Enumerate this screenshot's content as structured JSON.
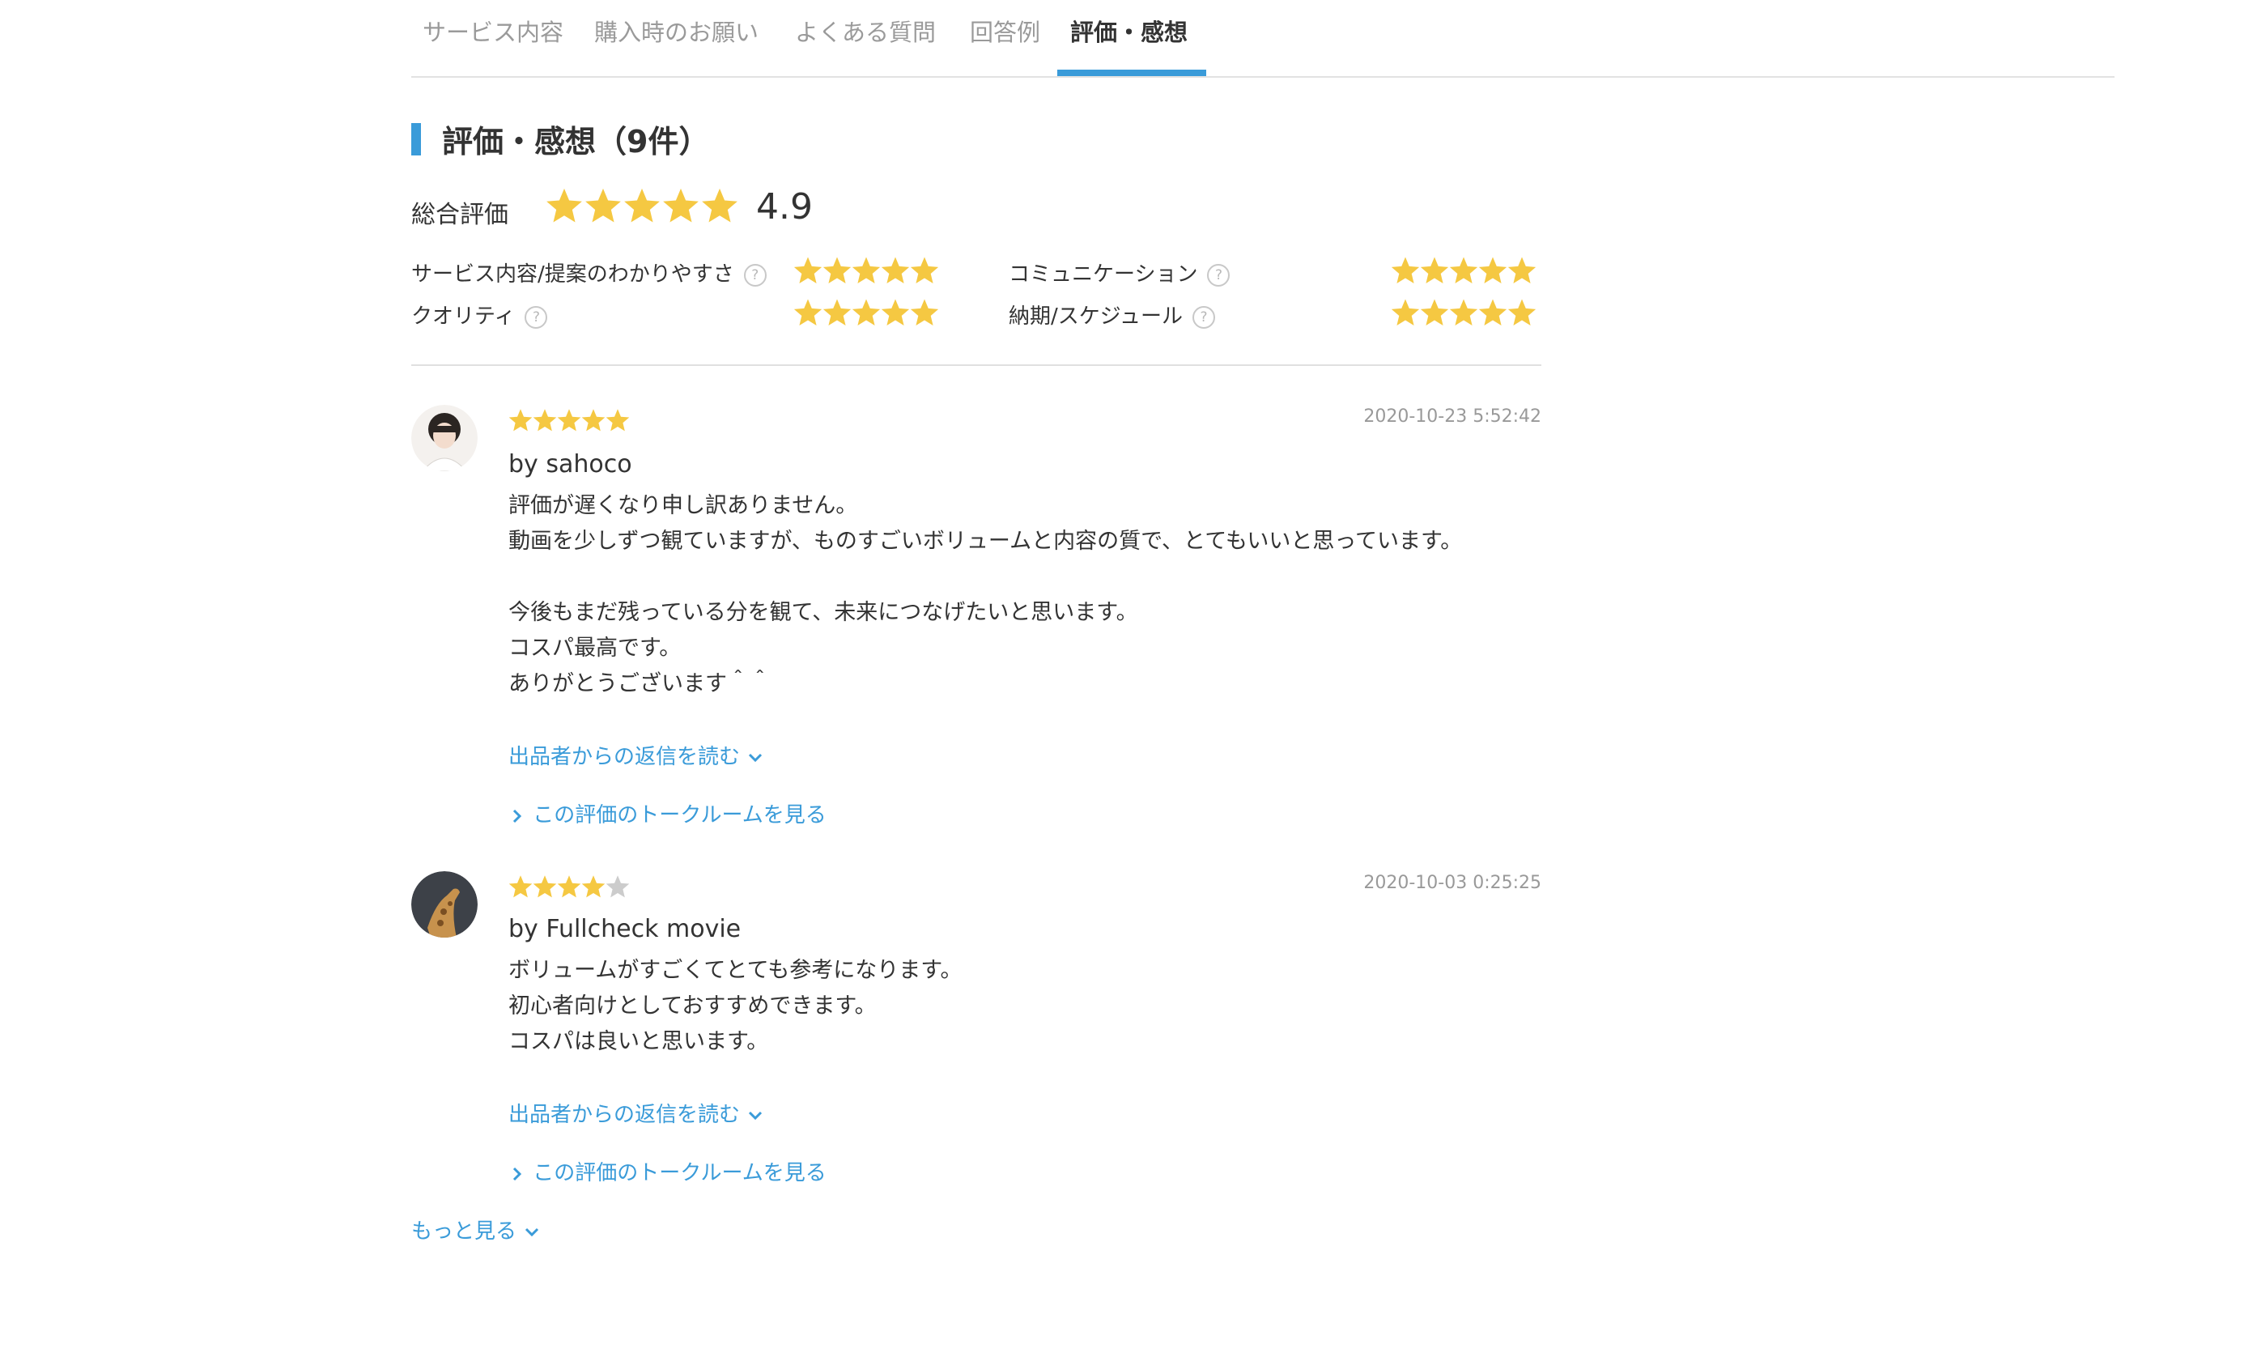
{
  "tabs": [
    {
      "label": "サービス内容"
    },
    {
      "label": "購入時のお願い"
    },
    {
      "label": "よくある質問"
    },
    {
      "label": "回答例"
    },
    {
      "label": "評価・感想",
      "active": true
    }
  ],
  "section": {
    "title": "評価・感想（9件）"
  },
  "overall": {
    "label": "総合評価",
    "score": "4.9",
    "stars": 5
  },
  "sub_ratings": [
    {
      "label": "サービス内容/提案のわかりやすさ",
      "stars": 5,
      "help": "?"
    },
    {
      "label": "コミュニケーション",
      "stars": 5,
      "help": "?"
    },
    {
      "label": "クオリティ",
      "stars": 5,
      "help": "?"
    },
    {
      "label": "納期/スケジュール",
      "stars": 5,
      "help": "?"
    }
  ],
  "reviews": [
    {
      "stars": 5,
      "date": "2020-10-23 5:52:42",
      "author": "by sahoco",
      "lines": [
        "評価が遅くなり申し訳ありません。",
        "動画を少しずつ観ていますが、ものすごいボリュームと内容の質で、とてもいいと思っています。",
        "",
        "今後もまだ残っている分を観て、未来につなげたいと思います。",
        "コスパ最高です。",
        "ありがとうございます＾＾"
      ],
      "reply_link": "出品者からの返信を読む",
      "talkroom_link": "この評価のトークルームを見る"
    },
    {
      "stars": 4,
      "date": "2020-10-03 0:25:25",
      "author": "by Fullcheck movie",
      "lines": [
        "ボリュームがすごくてとても参考になります。",
        "初心者向けとしておすすめできます。",
        "コスパは良いと思います。"
      ],
      "reply_link": "出品者からの返信を読む",
      "talkroom_link": "この評価のトークルームを見る"
    }
  ],
  "more_link": "もっと見る",
  "colors": {
    "accent": "#3a9bd9",
    "star_on": "#f5c842",
    "star_off": "#cccccc"
  }
}
